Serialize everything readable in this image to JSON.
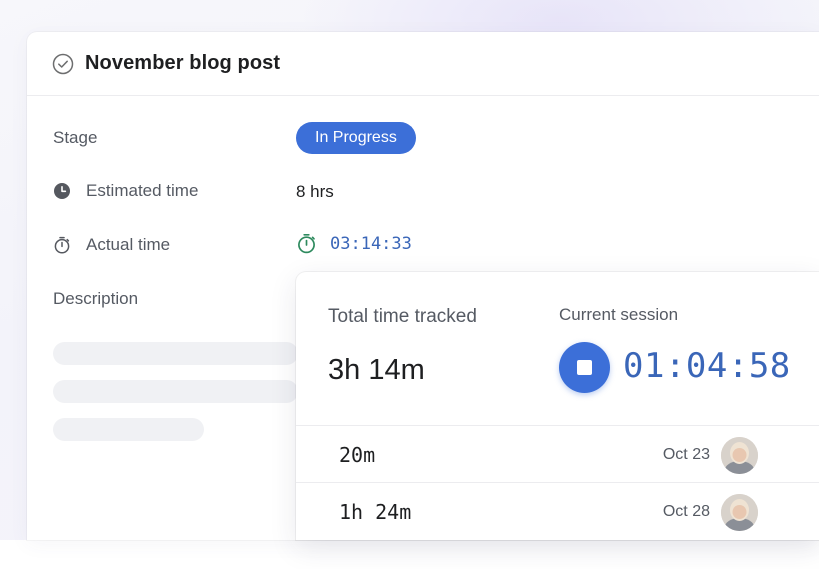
{
  "card": {
    "title": "November blog post",
    "fields": {
      "stage": {
        "label": "Stage",
        "value": "In Progress",
        "color": "#3c6fd8"
      },
      "estimated": {
        "label": "Estimated time",
        "value": "8 hrs",
        "icon": "clock-icon"
      },
      "actual": {
        "label": "Actual time",
        "value": "03:14:33",
        "icon": "stopwatch-icon"
      },
      "description": {
        "label": "Description"
      }
    }
  },
  "tracker": {
    "total_label": "Total time tracked",
    "total_value": "3h 14m",
    "session_label": "Current session",
    "session_value": "01:04:58",
    "entries": [
      {
        "duration": "20m",
        "date": "Oct 23"
      },
      {
        "duration": "1h 24m",
        "date": "Oct 28"
      }
    ]
  },
  "colors": {
    "accent": "#3c6fd8",
    "timer": "#3a66b8",
    "stopwatch_green": "#2e8a5e"
  }
}
